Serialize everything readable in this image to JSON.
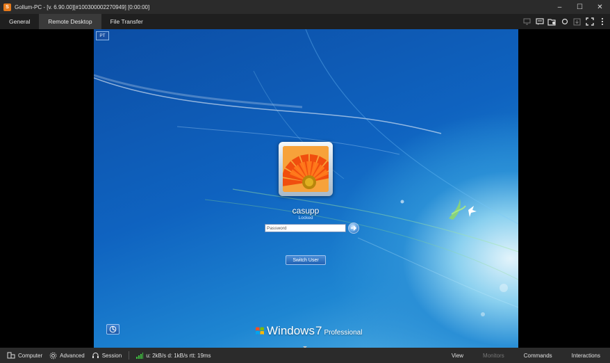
{
  "window": {
    "title": "Gollum-PC - [v. 6.90.00][#1003000022709​49] [0:00:00]",
    "app_icon_glyph": "S",
    "controls": {
      "minimize": "–",
      "maximize": "☐",
      "close": "✕"
    }
  },
  "tabs": [
    {
      "label": "General",
      "active": false
    },
    {
      "label": "Remote Desktop",
      "active": true
    },
    {
      "label": "File Transfer",
      "active": false
    }
  ],
  "toolbar_icons": [
    "screen-icon",
    "chat-icon",
    "folder-gear-icon",
    "record-icon",
    "download-icon",
    "fullscreen-icon",
    "more-icon"
  ],
  "remote": {
    "pt_badge": "PT",
    "username": "casupp",
    "status": "Locked",
    "password_placeholder": "Password",
    "switch_user_label": "Switch User",
    "windows_brand": {
      "word": "Windows",
      "version": "7",
      "edition": "Professional"
    }
  },
  "statusbar": {
    "computer_label": "Computer",
    "advanced_label": "Advanced",
    "session_label": "Session",
    "stats": "u: 2kB/s d: 1kB/s rtt: 19ms",
    "menus": [
      {
        "label": "View",
        "enabled": true
      },
      {
        "label": "Monitors",
        "enabled": false
      },
      {
        "label": "Commands",
        "enabled": true
      },
      {
        "label": "Interactions",
        "enabled": true
      }
    ]
  },
  "colors": {
    "accent_orange": "#e87a1a",
    "signal_green": "#3fbf3f",
    "desktop_blue": "#0f63c0"
  }
}
